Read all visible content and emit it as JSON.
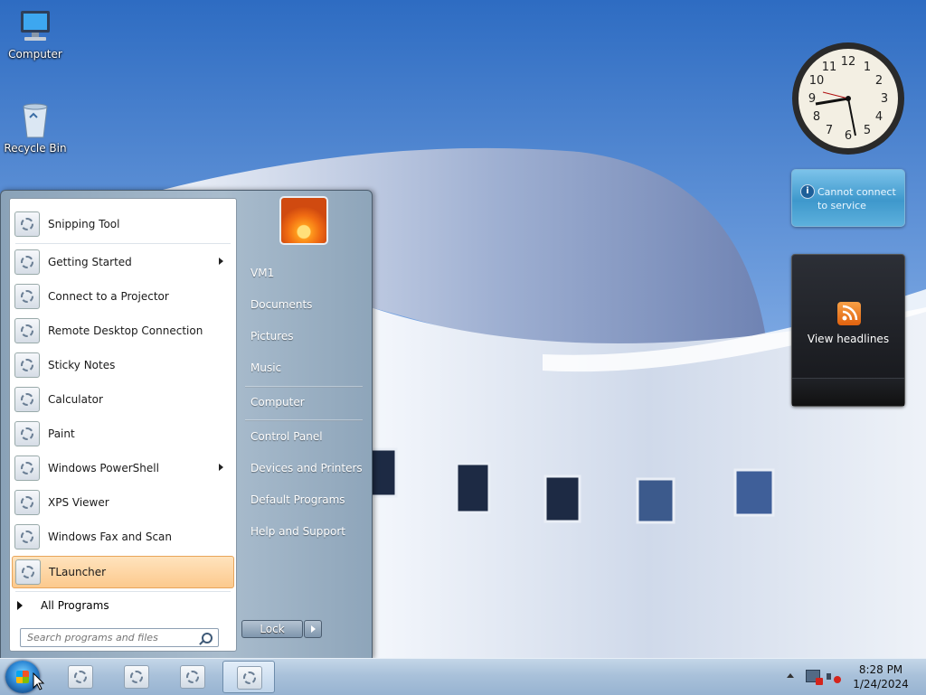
{
  "desktop": {
    "icons": [
      {
        "label": "Computer",
        "icon": "computer-icon"
      },
      {
        "label": "Recycle Bin",
        "icon": "recycle-bin-icon"
      }
    ]
  },
  "gadgets": {
    "clock": {
      "time": "8:28"
    },
    "weather": {
      "message": "Cannot connect to service"
    },
    "feed": {
      "label": "View headlines",
      "icon": "rss-icon"
    }
  },
  "start_menu": {
    "programs": [
      {
        "label": "Snipping Tool",
        "submenu": false
      },
      {
        "label": "Getting Started",
        "submenu": true
      },
      {
        "label": "Connect to a Projector",
        "submenu": false
      },
      {
        "label": "Remote Desktop Connection",
        "submenu": false
      },
      {
        "label": "Sticky Notes",
        "submenu": false
      },
      {
        "label": "Calculator",
        "submenu": false
      },
      {
        "label": "Paint",
        "submenu": false
      },
      {
        "label": "Windows PowerShell",
        "submenu": true
      },
      {
        "label": "XPS Viewer",
        "submenu": false
      },
      {
        "label": "Windows Fax and Scan",
        "submenu": false
      },
      {
        "label": "TLauncher",
        "submenu": false,
        "selected": true
      }
    ],
    "all_programs": "All Programs",
    "search_placeholder": "Search programs and files",
    "right_items": [
      "VM1",
      "Documents",
      "Pictures",
      "Music",
      "Computer",
      "Control Panel",
      "Devices and Printers",
      "Default Programs",
      "Help and Support"
    ],
    "lock_label": "Lock"
  },
  "taskbar": {
    "time": "8:28 PM",
    "date": "1/24/2024",
    "buttons": 4
  },
  "colors": {
    "selection": "#fcc98d",
    "taskbar": "#a9c1da"
  }
}
